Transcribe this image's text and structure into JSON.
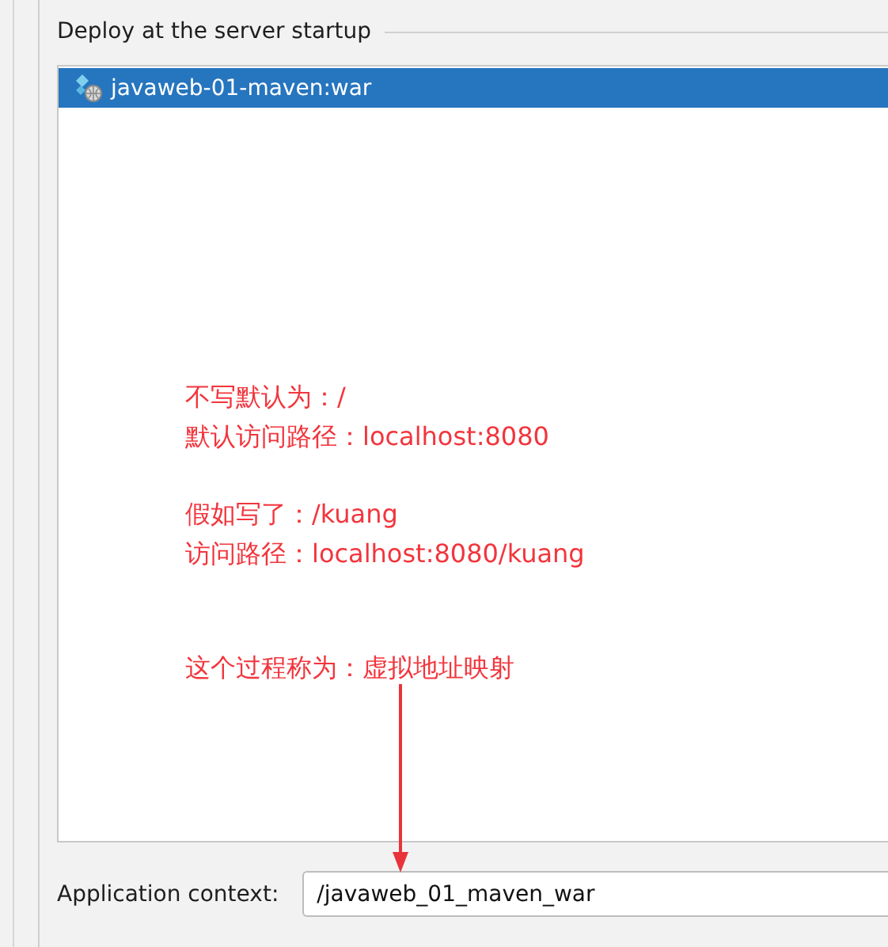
{
  "group": {
    "title": "Deploy at the server startup"
  },
  "artifacts": [
    {
      "label": "javaweb-01-maven:war",
      "selected": true
    }
  ],
  "annotation": {
    "paragraphs": [
      {
        "lines": [
          "不写默认为：/",
          "默认访问路径：localhost:8080"
        ]
      },
      {
        "lines": [
          "假如写了：/kuang",
          "访问路径：localhost:8080/kuang"
        ]
      },
      {
        "lines": [
          "这个过程称为：虚拟地址映射"
        ]
      }
    ]
  },
  "context": {
    "label": "Application context:",
    "value": "/javaweb_01_maven_war"
  }
}
